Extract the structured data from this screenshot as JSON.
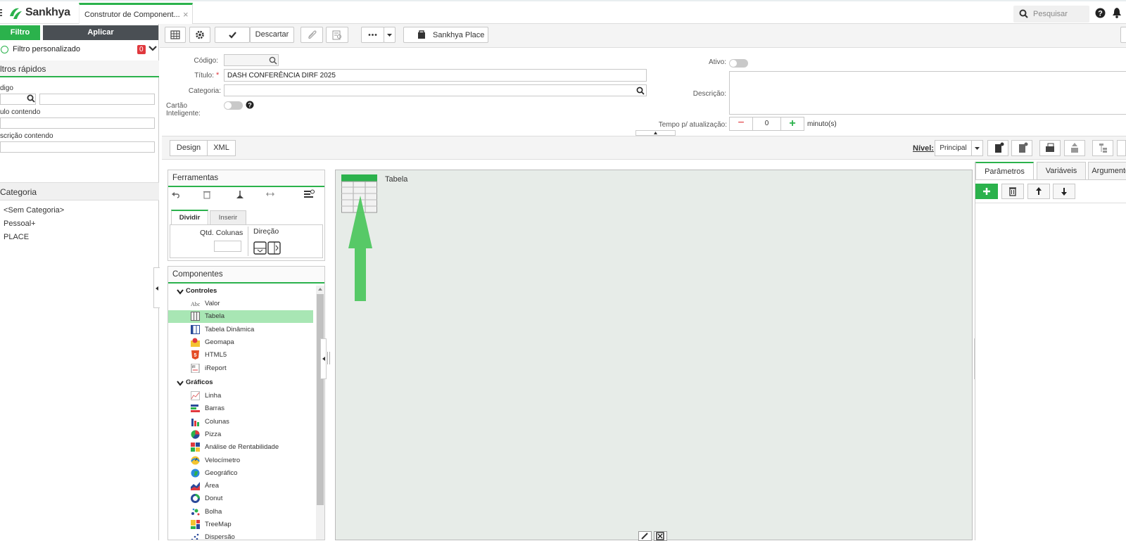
{
  "topbar": {
    "brand": "Sankhya",
    "tab_title": "Construtor de Component...",
    "tab_close": "×",
    "search_placeholder": "Pesquisar"
  },
  "filter_panel": {
    "filtro_label": "Filtro",
    "aplicar_label": "Aplicar",
    "custom_filter_label": "Filtro personalizado",
    "custom_filter_count": "0",
    "quick_filters_title": "ltros rápidos",
    "codigo_label": "digo",
    "titulo_label": "ulo contendo",
    "descricao_label": "scrição contendo",
    "categoria_title": "Categoria",
    "categories": [
      "<Sem Categoria>",
      "Pessoal+",
      "PLACE"
    ]
  },
  "toolbar": {
    "descartar_label": "Descartar",
    "sankhya_place_label": "Sankhya Place"
  },
  "form": {
    "codigo_label": "Código:",
    "codigo_value": "",
    "titulo_label": "Título:",
    "titulo_required": "*",
    "titulo_value": "DASH CONFERÊNCIA DIRF 2025",
    "categoria_label": "Categoria:",
    "categoria_value": "",
    "cartao_label": "Cartão Inteligente:",
    "ativo_label": "Ativo:",
    "descricao_label": "Descrição:",
    "descricao_value": "",
    "tempo_label": "Tempo p/ atualização:",
    "tempo_value": "0",
    "tempo_unit": "minuto(s)",
    "minus": "−",
    "plus": "+"
  },
  "design_bar": {
    "design_tab": "Design",
    "xml_tab": "XML",
    "nivel_label": "Nível:",
    "nivel_value": "Principal"
  },
  "ferramentas": {
    "title": "Ferramentas",
    "tab_dividir": "Dividir",
    "tab_inserir": "Inserir",
    "qtd_colunas_label": "Qtd. Colunas",
    "direcao_label": "Direção"
  },
  "componentes": {
    "title": "Componentes",
    "group_controles": "Controles",
    "controles": [
      {
        "label": "Valor",
        "icon": "abc-icon"
      },
      {
        "label": "Tabela",
        "icon": "table-icon",
        "selected": true
      },
      {
        "label": "Tabela Dinâmica",
        "icon": "pivot-table-icon"
      },
      {
        "label": "Geomapa",
        "icon": "geomap-icon"
      },
      {
        "label": "HTML5",
        "icon": "html5-icon"
      },
      {
        "label": "iReport",
        "icon": "ireport-icon"
      }
    ],
    "group_graficos": "Gráficos",
    "graficos": [
      {
        "label": "Linha",
        "icon": "line-chart-icon"
      },
      {
        "label": "Barras",
        "icon": "bar-chart-icon"
      },
      {
        "label": "Colunas",
        "icon": "column-chart-icon"
      },
      {
        "label": "Pizza",
        "icon": "pie-chart-icon"
      },
      {
        "label": "Análise de Rentabilidade",
        "icon": "profitability-icon"
      },
      {
        "label": "Velocímetro",
        "icon": "gauge-icon"
      },
      {
        "label": "Geográfico",
        "icon": "globe-icon"
      },
      {
        "label": "Área",
        "icon": "area-chart-icon"
      },
      {
        "label": "Donut",
        "icon": "donut-chart-icon"
      },
      {
        "label": "Bolha",
        "icon": "bubble-chart-icon"
      },
      {
        "label": "TreeMap",
        "icon": "treemap-icon"
      },
      {
        "label": "Dispersão",
        "icon": "scatter-chart-icon"
      }
    ]
  },
  "canvas": {
    "component_label": "Tabela"
  },
  "right_panel": {
    "tab_parametros": "Parâmetros",
    "tab_variaveis": "Variáveis",
    "tab_argumentos": "Argumentos"
  },
  "colors": {
    "accent_green": "#2bb24c",
    "dark_button": "#4a4f54",
    "badge_red": "#e0393e",
    "selected_row": "#a8e6b4",
    "canvas_bg": "#e7ece8"
  }
}
